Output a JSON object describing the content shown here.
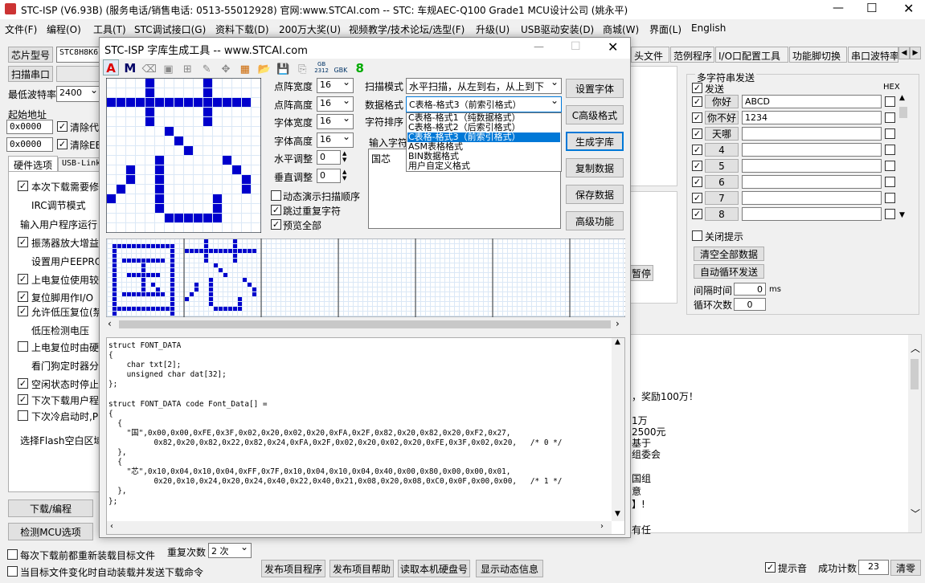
{
  "app": {
    "title": "STC-ISP (V6.93B) (服务电话/销售电话: 0513-55012928) 官网:www.STCAI.com  -- STC: 车规AEC-Q100 Grade1 MCU设计公司 (姚永平)"
  },
  "menu": [
    "文件(F)",
    "编程(O)",
    "工具(T)",
    "STC调试接口(G)",
    "资料下载(D)",
    "200万大奖(U)",
    "视频教学/技术论坛/选型(F)",
    "升级(U)",
    "USB驱动安装(D)",
    "商城(W)",
    "界面(L)",
    "English"
  ],
  "left": {
    "chip_btn": "芯片型号",
    "chip_value": "STC8H8K6",
    "scan_btn": "扫描串口",
    "baud_label": "最低波特率",
    "baud_value": "2400",
    "start_label": "起始地址",
    "addr1": "0x0000",
    "addr2": "0x0000",
    "clear1": "清除代",
    "clear2": "清除EE",
    "tab_hw": "硬件选项",
    "tab_usb": "USB-Link",
    "options": [
      "本次下载需要修",
      "IRC调节模式",
      "输入用户程序运行",
      "振荡器放大增益",
      "设置用户EEPROM",
      "上电复位使用较",
      "复位脚用作I/O",
      "允许低压复位(禁",
      "低压检测电压",
      "上电复位时由硬",
      "看门狗定时器分",
      "空闲状态时停止",
      "下次下载用户程",
      "下次冷启动时,P",
      "选择Flash空白区域"
    ],
    "download_btn": "下载/编程",
    "detect_btn": "检测MCU选项"
  },
  "bottom": {
    "reload": "每次下载前都重新装载目标文件",
    "repeat_label": "重复次数",
    "repeat_value": "2 次",
    "auto_reload": "当目标文件变化时自动装载并发送下载命令",
    "publish": "发布项目程序",
    "publish_help": "发布项目帮助",
    "read_disk": "读取本机硬盘号",
    "show_dynamic": "显示动态信息",
    "tip_sound": "提示音",
    "success_label": "成功计数",
    "success_value": "23",
    "clear": "清零"
  },
  "right_tabs": [
    "头文件",
    "范例程序",
    "I/O口配置工具",
    "功能脚切换",
    "串口波特率"
  ],
  "multi": {
    "title": "多字符串发送",
    "send": "发送",
    "hex": "HEX",
    "rows": [
      {
        "label": "你好",
        "value": "ABCD"
      },
      {
        "label": "你不好",
        "value": "1234"
      },
      {
        "label": "天哪",
        "value": ""
      },
      {
        "label": "4",
        "value": ""
      },
      {
        "label": "5",
        "value": ""
      },
      {
        "label": "6",
        "value": ""
      },
      {
        "label": "7",
        "value": ""
      },
      {
        "label": "8",
        "value": ""
      }
    ],
    "close_tip": "关闭提示",
    "clear_all": "清空全部数据",
    "auto_loop": "自动循环发送",
    "interval_label": "间隔时间",
    "interval_value": "0",
    "interval_unit": "ms",
    "loop_label": "循环次数",
    "loop_value": "0"
  },
  "pause": "暂停",
  "bg_text": [
    "，奖励100万！",
    "1万",
    "2500元",
    "基于",
    "组委会",
    "国组",
    "意",
    "】!",
    "有任"
  ],
  "dialog": {
    "title": "STC-ISP 字库生成工具 -- www.STCAI.com",
    "tb_gb": "GB 2312",
    "tb_gbk": "GBK",
    "tb_8": "8",
    "dot_w_label": "点阵宽度",
    "dot_w": "16",
    "dot_h_label": "点阵高度",
    "dot_h": "16",
    "font_w_label": "字体宽度",
    "font_w": "16",
    "font_h_label": "字体高度",
    "font_h": "16",
    "h_adj_label": "水平调整",
    "h_adj": "0",
    "v_adj_label": "垂直调整",
    "v_adj": "0",
    "dyn_scan": "动态演示扫描顺序",
    "skip_dup": "跳过重复字符",
    "preview_all": "预览全部",
    "scan_label": "扫描模式",
    "scan_value": "水平扫描，从左到右，从上到下",
    "format_label": "数据格式",
    "format_value": "C表格-格式3（前索引格式）",
    "sort_label": "字符排序",
    "input_label": "输入字符",
    "input_value": "国芯",
    "dropdown": [
      "C表格-格式1（纯数据格式）",
      "C表格-格式2（后索引格式）",
      "C表格-格式3（前索引格式）",
      "ASM表格格式",
      "BIN数据格式",
      "用户自定义格式"
    ],
    "btn_font": "设置字体",
    "btn_adv": "C高级格式",
    "btn_gen": "生成字库",
    "btn_copy": "复制数据",
    "btn_save": "保存数据",
    "btn_high": "高级功能",
    "code": "struct FONT_DATA\n{\n    char txt[2];\n    unsigned char dat[32];\n};\n\nstruct FONT_DATA code Font_Data[] =\n{\n  {\n    \"国\",0x00,0x00,0xFE,0x3F,0x02,0x20,0x02,0x20,0xFA,0x2F,0x82,0x20,0x82,0x20,0xF2,0x27,\n          0x82,0x20,0x82,0x22,0x82,0x24,0xFA,0x2F,0x02,0x20,0x02,0x20,0xFE,0x3F,0x02,0x20,   /* 0 */\n  },\n  {\n    \"芯\",0x10,0x04,0x10,0x04,0xFF,0x7F,0x10,0x04,0x10,0x04,0x40,0x00,0x80,0x00,0x00,0x01,\n          0x20,0x10,0x24,0x20,0x24,0x40,0x22,0x40,0x21,0x08,0x20,0x08,0xC0,0x0F,0x00,0x00,   /* 1 */\n  },\n};"
  }
}
